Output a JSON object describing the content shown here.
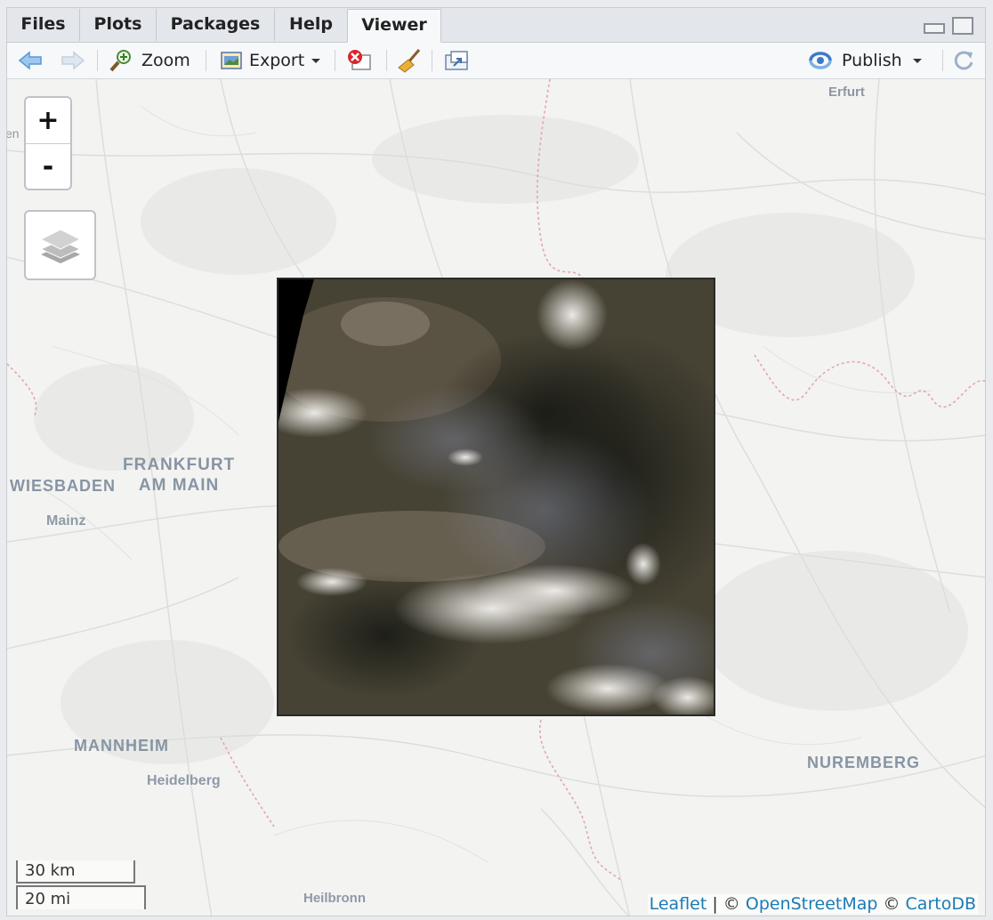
{
  "tabs": [
    {
      "label": "Files",
      "active": false
    },
    {
      "label": "Plots",
      "active": false
    },
    {
      "label": "Packages",
      "active": false
    },
    {
      "label": "Help",
      "active": false
    },
    {
      "label": "Viewer",
      "active": true
    }
  ],
  "toolbar": {
    "zoom_label": "Zoom",
    "export_label": "Export",
    "publish_label": "Publish"
  },
  "map": {
    "zoom_in": "+",
    "zoom_out": "-",
    "labels": {
      "erfurt": "Erfurt",
      "frankfurt": "FRANKFURT\nAM MAIN",
      "wiesbaden": "WIESBADEN",
      "mainz": "Mainz",
      "mannheim": "MANNHEIM",
      "heidelberg": "Heidelberg",
      "heilbronn": "Heilbronn",
      "nuremberg": "NUREMBERG",
      "edge_partial": "en"
    },
    "scale": {
      "metric": "30 km",
      "imperial": "20 mi"
    },
    "attribution": {
      "leaflet": "Leaflet",
      "sep1": "| ©",
      "osm": "OpenStreetMap",
      "sep2": "©",
      "carto": "CartoDB"
    }
  },
  "icons": [
    "back-arrow-icon",
    "forward-arrow-icon",
    "zoom-icon",
    "export-icon",
    "remove-icon",
    "broom-icon",
    "popout-icon",
    "publish-icon",
    "refresh-icon",
    "layers-icon"
  ],
  "colors": {
    "accent_link": "#1b7bb5",
    "map_bg": "#f2f2f2",
    "border_dashed": "#e3a5ad"
  }
}
